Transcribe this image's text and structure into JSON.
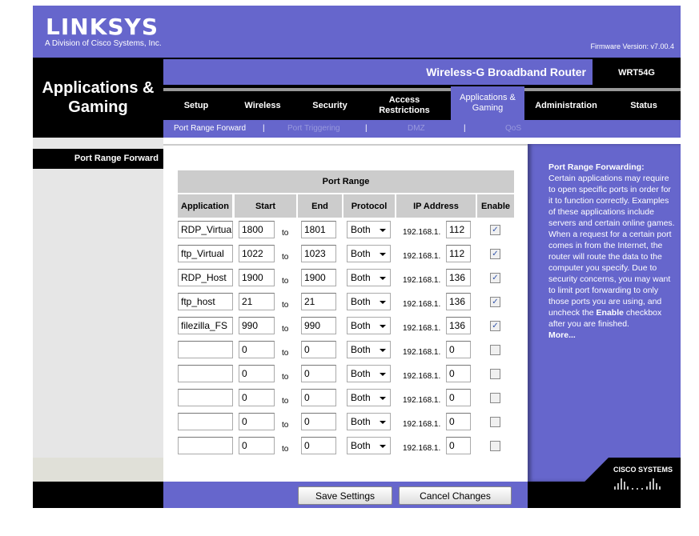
{
  "header": {
    "brand": "LINKSYS",
    "brand_sub": "A Division of Cisco Systems, Inc.",
    "firmware": "Firmware Version: v7.00.4",
    "section_title": "Applications & Gaming",
    "router_name": "Wireless-G Broadband Router",
    "model": "WRT54G"
  },
  "nav": {
    "tabs": [
      {
        "label": "Setup"
      },
      {
        "label": "Wireless"
      },
      {
        "label": "Security"
      },
      {
        "label": "Access Restrictions"
      },
      {
        "label": "Applications & Gaming",
        "active": true
      },
      {
        "label": "Administration"
      },
      {
        "label": "Status"
      }
    ],
    "subtabs": [
      {
        "label": "Port Range Forward",
        "active": true
      },
      {
        "label": "Port Triggering"
      },
      {
        "label": "DMZ"
      },
      {
        "label": "QoS"
      }
    ],
    "separator": "|"
  },
  "sidebar": {
    "item": "Port Range Forward"
  },
  "table": {
    "group_header": "Port Range",
    "columns": [
      "Application",
      "Start",
      "End",
      "Protocol",
      "IP Address",
      "Enable"
    ],
    "to_label": "to",
    "ip_prefix": "192.168.1.",
    "rows": [
      {
        "app": "RDP_Virtual",
        "start": "1800",
        "end": "1801",
        "protocol": "Both",
        "ip": "112",
        "enabled": true
      },
      {
        "app": "ftp_Virtual",
        "start": "1022",
        "end": "1023",
        "protocol": "Both",
        "ip": "112",
        "enabled": true
      },
      {
        "app": "RDP_Host",
        "start": "1900",
        "end": "1900",
        "protocol": "Both",
        "ip": "136",
        "enabled": true
      },
      {
        "app": "ftp_host",
        "start": "21",
        "end": "21",
        "protocol": "Both",
        "ip": "136",
        "enabled": true
      },
      {
        "app": "filezilla_FS",
        "start": "990",
        "end": "990",
        "protocol": "Both",
        "ip": "136",
        "enabled": true
      },
      {
        "app": "",
        "start": "0",
        "end": "0",
        "protocol": "Both",
        "ip": "0",
        "enabled": false
      },
      {
        "app": "",
        "start": "0",
        "end": "0",
        "protocol": "Both",
        "ip": "0",
        "enabled": false
      },
      {
        "app": "",
        "start": "0",
        "end": "0",
        "protocol": "Both",
        "ip": "0",
        "enabled": false
      },
      {
        "app": "",
        "start": "0",
        "end": "0",
        "protocol": "Both",
        "ip": "0",
        "enabled": false
      },
      {
        "app": "",
        "start": "0",
        "end": "0",
        "protocol": "Both",
        "ip": "0",
        "enabled": false
      }
    ]
  },
  "help": {
    "title": "Port Range Forwarding:",
    "text1": "Certain applications may require to open specific ports in order for it to function correctly. Examples of these applications include servers and certain online games. When a request for a certain port comes in from the Internet, the router will route the data to the computer you specify. Due to security concerns, you may want to limit port forwarding to only those ports you are using, and uncheck the ",
    "bold": "Enable",
    "text2": " checkbox after you are finished.",
    "more": "More..."
  },
  "footer": {
    "save": "Save Settings",
    "cancel": "Cancel Changes",
    "cisco": "CISCO SYSTEMS"
  },
  "colors": {
    "purple": "#6666cc",
    "black": "#000000"
  }
}
